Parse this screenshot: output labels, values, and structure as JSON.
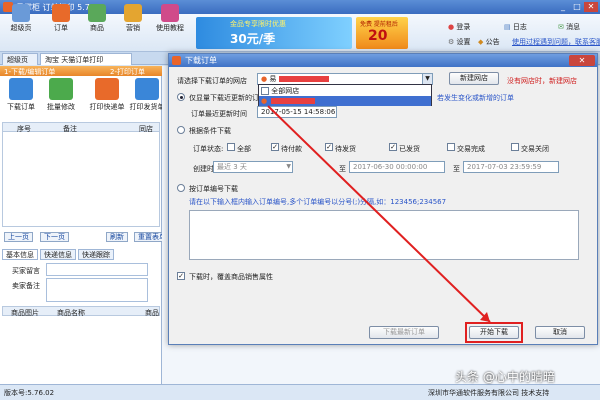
{
  "window": {
    "title": "易掌柜 订单打印 5.76",
    "min": "_",
    "max": "□",
    "close": "✕"
  },
  "toolbar": {
    "items": [
      {
        "label": "超级页",
        "icon": "home-icon",
        "color": "#6a9ad8"
      },
      {
        "label": "订单",
        "icon": "order-icon",
        "color": "#e86a2a"
      },
      {
        "label": "商品",
        "icon": "product-icon",
        "color": "#5aa85a"
      },
      {
        "label": "营销",
        "icon": "marketing-icon",
        "color": "#e4a530"
      },
      {
        "label": "使用教程",
        "icon": "tutorial-icon",
        "color": "#d04a8a"
      }
    ],
    "right": [
      {
        "label": "登录",
        "icon": "login-icon"
      },
      {
        "label": "日志",
        "icon": "log-icon"
      },
      {
        "label": "消息",
        "icon": "message-icon"
      },
      {
        "label": "设置",
        "icon": "settings-icon"
      },
      {
        "label": "公告",
        "icon": "notice-icon"
      }
    ],
    "help_text": "使用过程遇到问题，联系客服",
    "colors": {
      "bar": "#3a6cc0",
      "accent": "#e8642a"
    }
  },
  "banners": {
    "b1_line1": "金品专享限时优惠",
    "b1_price": "30元/季",
    "b2_price": "20",
    "b2_line": "免费 提前租后"
  },
  "tabs": {
    "t1": "超级页",
    "t2": "淘宝 天猫订单打印"
  },
  "left": {
    "step1": "1-下载/编辑订单",
    "step2": "2-打印订单",
    "buttons": {
      "download": "下载订单",
      "batch_edit": "批量修改",
      "print_express": "打印快递单",
      "print_delivery": "打印发货单"
    },
    "grid_cols": [
      "序号",
      "备注",
      "同店"
    ],
    "pager": {
      "prev": "上一页",
      "next": "下一页",
      "refresh": "刷新",
      "reset": "重置表单"
    },
    "info_tabs": [
      "基本信息",
      "快递信息",
      "快递跟踪"
    ],
    "labels": {
      "buyer_note": "买家留言",
      "seller_note": "卖家备注",
      "img": "商品图片",
      "name": "商品名称",
      "spec": "商品"
    }
  },
  "status": {
    "version": "版本号:5.76.02",
    "copyright": "深圳市华通软件服务有限公司 技术支持"
  },
  "watermark": "头条 @心中的晴暗",
  "dialog": {
    "title": "下载订单",
    "close": "✕",
    "shop_label": "请选择下载订单的网店",
    "shop_value": "易",
    "add_shop": "新建网店",
    "no_shop": "没有网店时，新建网店",
    "dropdown": {
      "all": "全部网店"
    },
    "radio_incremental": "仅显量下载近更新的订单",
    "hint_red": "若发生变化或新增的订单",
    "last_time_label": "订单最近更新时间",
    "last_time": "2017-05-15 14:58:06",
    "radio_condition": "根据条件下载",
    "status_label": "订单状态:",
    "statuses": [
      {
        "label": "全部",
        "checked": false
      },
      {
        "label": "待付款",
        "checked": true
      },
      {
        "label": "待发货",
        "checked": true
      },
      {
        "label": "已发货",
        "checked": true
      },
      {
        "label": "交易完成",
        "checked": false
      },
      {
        "label": "交易关闭",
        "checked": false
      }
    ],
    "created_label": "创建时间",
    "created_range": "最近 3 天",
    "to": "至",
    "from_date": "2017-06-30 00:00:00",
    "to_date": "2017-07-03 23:59:59",
    "radio_by_number": "按订单编号下载",
    "number_hint": "请在以下输入框内输入订单编号,多个订单编号以分号(;)分隔,如：123456;234567",
    "chk_goods": "下载时，覆盖商品销售属性",
    "btn_incremental": "下载最新订单",
    "btn_start": "开始下载",
    "btn_cancel": "取消"
  }
}
